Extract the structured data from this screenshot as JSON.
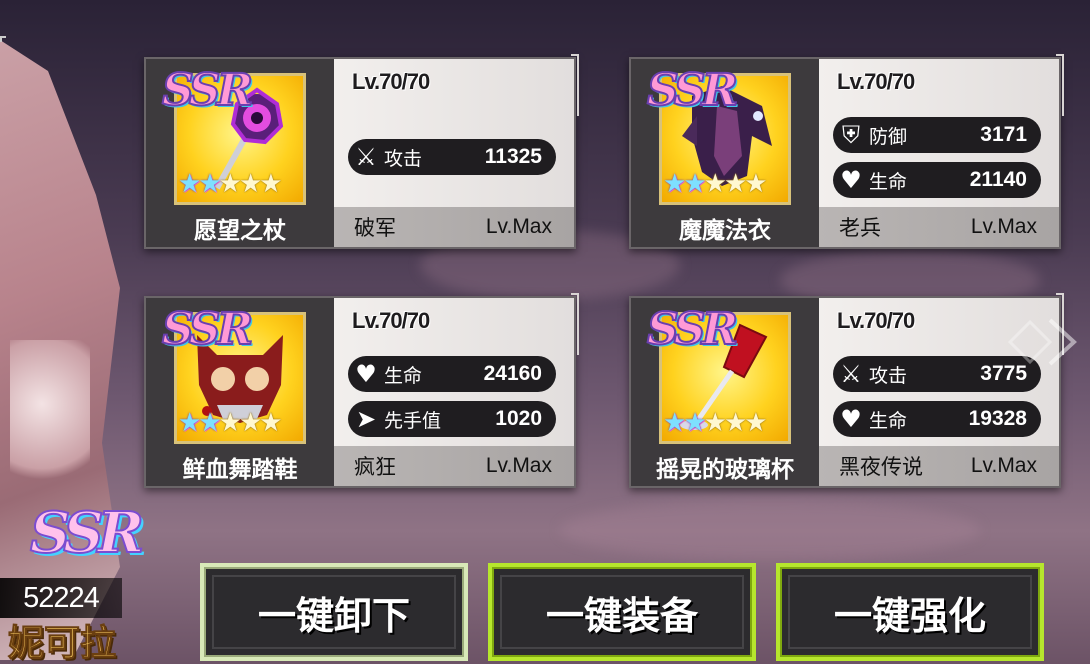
{
  "equipment": [
    {
      "rarity": "SSR",
      "name": "愿望之杖",
      "level": "Lv.70/70",
      "stars_rainbow": 2,
      "stars_total": 5,
      "stats": [
        {
          "icon": "crossed-swords-icon",
          "label": "攻击",
          "value": "11325"
        }
      ],
      "set_name": "破军",
      "enhance": "Lv.Max",
      "item_icon": "purple-flower-staff"
    },
    {
      "rarity": "SSR",
      "name": "魔魔法衣",
      "level": "Lv.70/70",
      "stars_rainbow": 2,
      "stars_total": 5,
      "stats": [
        {
          "icon": "shield-icon",
          "label": "防御",
          "value": "3171"
        },
        {
          "icon": "heart-icon",
          "label": "生命",
          "value": "21140"
        }
      ],
      "set_name": "老兵",
      "enhance": "Lv.Max",
      "item_icon": "dark-feather-robe"
    },
    {
      "rarity": "SSR",
      "name": "鲜血舞踏鞋",
      "level": "Lv.70/70",
      "stars_rainbow": 2,
      "stars_total": 5,
      "stats": [
        {
          "icon": "heart-icon",
          "label": "生命",
          "value": "24160"
        },
        {
          "icon": "speed-icon",
          "label": "先手值",
          "value": "1020"
        }
      ],
      "set_name": "疯狂",
      "enhance": "Lv.Max",
      "item_icon": "bloody-mask"
    },
    {
      "rarity": "SSR",
      "name": "摇晃的玻璃杯",
      "level": "Lv.70/70",
      "stars_rainbow": 2,
      "stars_total": 5,
      "stats": [
        {
          "icon": "crossed-swords-icon",
          "label": "攻击",
          "value": "3775"
        },
        {
          "icon": "heart-icon",
          "label": "生命",
          "value": "19328"
        }
      ],
      "set_name": "黑夜传说",
      "enhance": "Lv.Max",
      "item_icon": "wine-glass"
    }
  ],
  "actions": {
    "unload": "一键卸下",
    "equip": "一键装备",
    "enhance": "一键强化"
  },
  "character": {
    "rarity": "SSR",
    "power": "52224",
    "name": "妮可拉"
  },
  "colors": {
    "equip_accent": "#b6e62d",
    "icon_bg": "#ffd21f",
    "name_gold": "#ffd266"
  }
}
